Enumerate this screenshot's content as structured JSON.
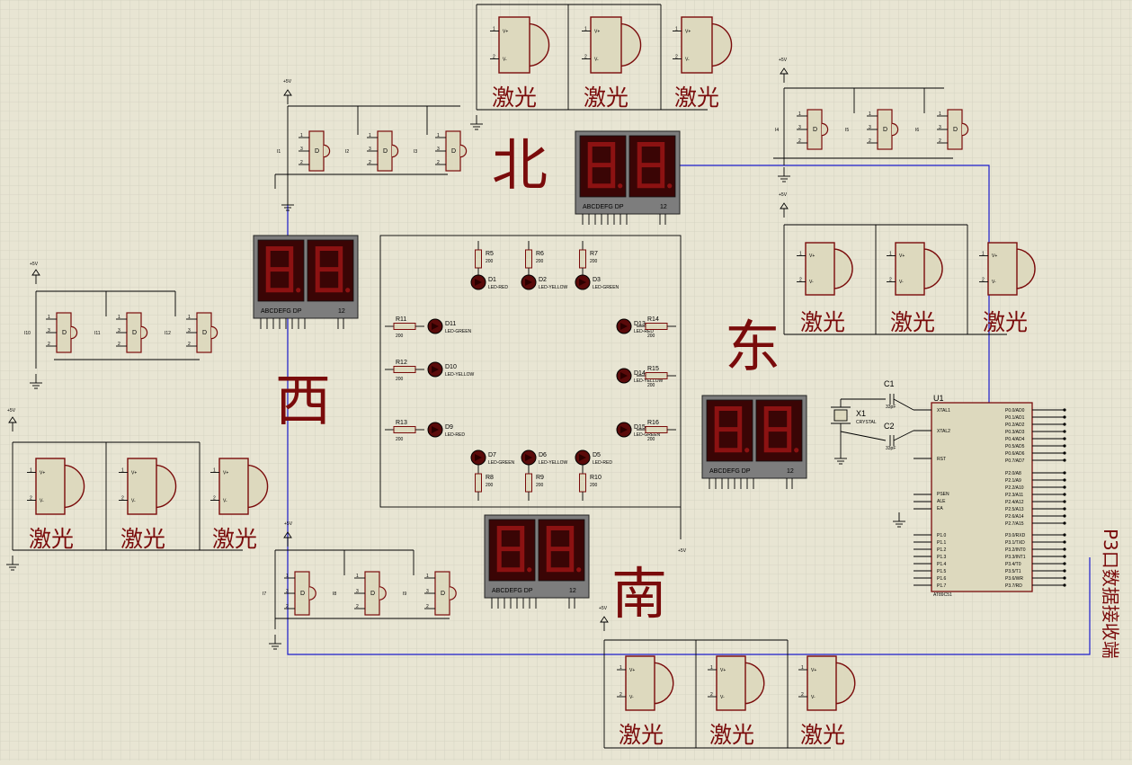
{
  "directions": {
    "north": "北",
    "south": "南",
    "east": "东",
    "west": "西"
  },
  "side_title": "P3口数据接收端",
  "laser_label": "激光",
  "power_label": "+5V",
  "chip": {
    "ref": "U1",
    "part": "AT89C51",
    "xtal1": "XTAL1",
    "xtal2": "XTAL2",
    "rst": "RST",
    "psen": "PSEN",
    "ale": "ALE",
    "ea": "EA",
    "p0": [
      "P0.0/AD0",
      "P0.1/AD1",
      "P0.2/AD2",
      "P0.3/AD3",
      "P0.4/AD4",
      "P0.5/AD5",
      "P0.6/AD6",
      "P0.7/AD7"
    ],
    "p2": [
      "P2.0/A8",
      "P2.1/A9",
      "P2.2/A10",
      "P2.3/A11",
      "P2.4/A12",
      "P2.5/A13",
      "P2.6/A14",
      "P2.7/A15"
    ],
    "p3": [
      "P3.0/RXD",
      "P3.1/TXD",
      "P3.2/INT0",
      "P3.3/INT1",
      "P3.4/T0",
      "P3.5/T1",
      "P3.6/WR",
      "P3.7/RD"
    ],
    "p1": [
      "P1.0",
      "P1.1",
      "P1.2",
      "P1.3",
      "P1.4",
      "P1.5",
      "P1.6",
      "P1.7"
    ]
  },
  "crystal": {
    "ref": "X1",
    "part": "CRYSTAL",
    "c1": "C1",
    "c2": "C2",
    "cap_value": "33pF"
  },
  "display_pins": "ABCDEFG DP",
  "display_digits": "12",
  "resistor_value": "200",
  "resistors": {
    "north": [
      "R5",
      "R6",
      "R7"
    ],
    "west": [
      "R11",
      "R12",
      "R13"
    ],
    "east": [
      "R14",
      "R15",
      "R16"
    ],
    "south": [
      "R8",
      "R9",
      "R10"
    ]
  },
  "leds": {
    "north": [
      {
        "ref": "D1",
        "type": "LED-RED"
      },
      {
        "ref": "D2",
        "type": "LED-YELLOW"
      },
      {
        "ref": "D3",
        "type": "LED-GREEN"
      }
    ],
    "west": [
      {
        "ref": "D11",
        "type": "LED-GREEN"
      },
      {
        "ref": "D10",
        "type": "LED-YELLOW"
      },
      {
        "ref": "D9",
        "type": "LED-RED"
      }
    ],
    "east": [
      {
        "ref": "D13",
        "type": "LED-RED"
      },
      {
        "ref": "D14",
        "type": "LED-YELLOW"
      },
      {
        "ref": "D15",
        "type": "LED-GREEN"
      }
    ],
    "south": [
      {
        "ref": "D7",
        "type": "LED-GREEN"
      },
      {
        "ref": "D6",
        "type": "LED-YELLOW"
      },
      {
        "ref": "D5",
        "type": "LED-RED"
      }
    ]
  },
  "gate_labels": {
    "north": [
      "I1",
      "I2",
      "I3"
    ],
    "east": [
      "I4",
      "I5",
      "I6"
    ],
    "west": [
      "I10",
      "I11",
      "I12"
    ],
    "south": [
      "I7",
      "I8",
      "I9"
    ]
  },
  "colors": {
    "ink": "#7a0b0b",
    "wire": "#1c1ccc",
    "grid": "#d1cfbe",
    "background": "#e8e5d3",
    "component_fill": "#ddd9be"
  }
}
